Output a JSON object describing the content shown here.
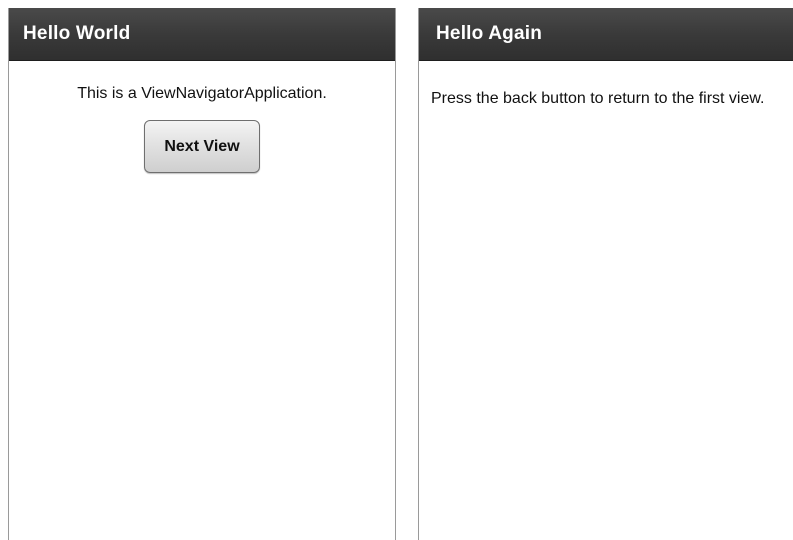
{
  "views": {
    "first": {
      "title": "Hello World",
      "message": "This is a ViewNavigatorApplication.",
      "next_button_label": "Next View"
    },
    "second": {
      "title": "Hello Again",
      "message": "Press the back button to return to the first view."
    }
  },
  "colors": {
    "action_bar": "#3a3a3a",
    "action_bar_text": "#ffffff",
    "content_background": "#ffffff",
    "text": "#111111"
  }
}
